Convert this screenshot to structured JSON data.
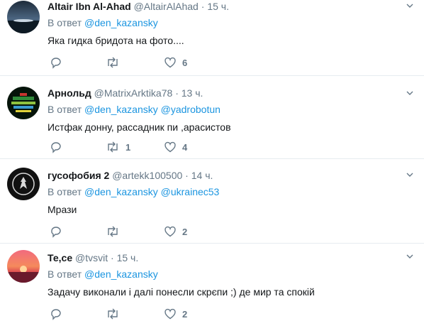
{
  "reply_prefix": "В ответ",
  "tweets": [
    {
      "name": "Altair Ibn Al-Ahad",
      "handle": "@AltairAlAhad",
      "separator": "·",
      "time": "15 ч.",
      "mentions": [
        "@den_kazansky"
      ],
      "text": "Яка гидка бридота на фото....",
      "replies": "",
      "retweets": "",
      "likes": "6"
    },
    {
      "name": "Арнольд",
      "handle": "@MatrixArktika78",
      "separator": "·",
      "time": "13 ч.",
      "mentions": [
        "@den_kazansky",
        "@yadrobotun"
      ],
      "text": "Истфак донну, рассадник пи ,арасистов",
      "replies": "",
      "retweets": "1",
      "likes": "4"
    },
    {
      "name": "гусофобия 2",
      "handle": "@artekk100500",
      "separator": "·",
      "time": "14 ч.",
      "mentions": [
        "@den_kazansky",
        "@ukrainec53"
      ],
      "text": "Мрази",
      "replies": "",
      "retweets": "",
      "likes": "2"
    },
    {
      "name": "Те,се",
      "handle": "@tvsvit",
      "separator": "·",
      "time": "15 ч.",
      "mentions": [
        "@den_kazansky"
      ],
      "text": "Задачу виконали і далі понесли скрєпи ;) де мир та спокій",
      "replies": "",
      "retweets": "",
      "likes": "2"
    }
  ],
  "colors": {
    "link": "#1b95e0",
    "secondary": "#657786",
    "divider": "#e6ecf0",
    "text": "#14171a"
  },
  "icons": [
    "reply-icon",
    "retweet-icon",
    "like-icon",
    "direct-message-icon",
    "chevron-down-icon"
  ]
}
